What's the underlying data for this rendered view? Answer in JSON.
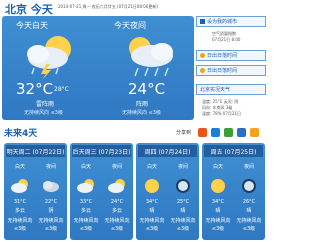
{
  "header": {
    "city": "北京",
    "day": "今天",
    "info": "2014-07-21  周一  农历六月廿五  (07月21日08:00更新)"
  },
  "today": {
    "day_title": "今天白天",
    "night_title": "今天夜间",
    "day_temp": "32°C",
    "night_temp": "24°C",
    "high_temp": "28°C",
    "day_weather": "雷阵雨",
    "night_weather": "阵雨",
    "day_wind": "无持续风向 ≤3级",
    "night_wind": "无持续风向 ≤3级"
  },
  "sidebar": {
    "btn1": "设为我的城市",
    "line1": "空气质量指数",
    "line2": "07月21日 8:00",
    "btn2": "日出日落时间",
    "btn3": "日出日落时间",
    "btn4": "北京实况天气",
    "live1": "温度: 25°C  云况: 阴",
    "live2": "风向: 东南风  3级",
    "live3": "湿度: 78%  07月21日"
  },
  "forecast": {
    "title": "未来4天",
    "share_label": "分享到",
    "share_icon_colors": [
      "#e8541a",
      "#1b7fd6",
      "#3a9f3a",
      "#2f6fc2",
      "#f3a21c"
    ],
    "labels": {
      "day": "白天",
      "night": "夜间"
    },
    "days": [
      {
        "head": "明天周二 (07月22日)",
        "day_temp": "31°C",
        "night_temp": "22°C",
        "day_w": "多云",
        "night_w": "阴",
        "wind": "无持续风向",
        "lvl": "≤3级"
      },
      {
        "head": "后天周三 (07月23日)",
        "day_temp": "33°C",
        "night_temp": "24°C",
        "day_w": "多云",
        "night_w": "多云",
        "wind": "无持续风向",
        "lvl": "≤3级"
      },
      {
        "head": "周四 (07月24日)",
        "day_temp": "34°C",
        "night_temp": "25°C",
        "day_w": "晴",
        "night_w": "晴",
        "wind": "无持续风向",
        "lvl": "≤3级"
      },
      {
        "head": "周五 (07月25日)",
        "day_temp": "34°C",
        "night_temp": "26°C",
        "day_w": "晴",
        "night_w": "晴",
        "wind": "无持续风向",
        "lvl": "≤3级"
      }
    ]
  }
}
